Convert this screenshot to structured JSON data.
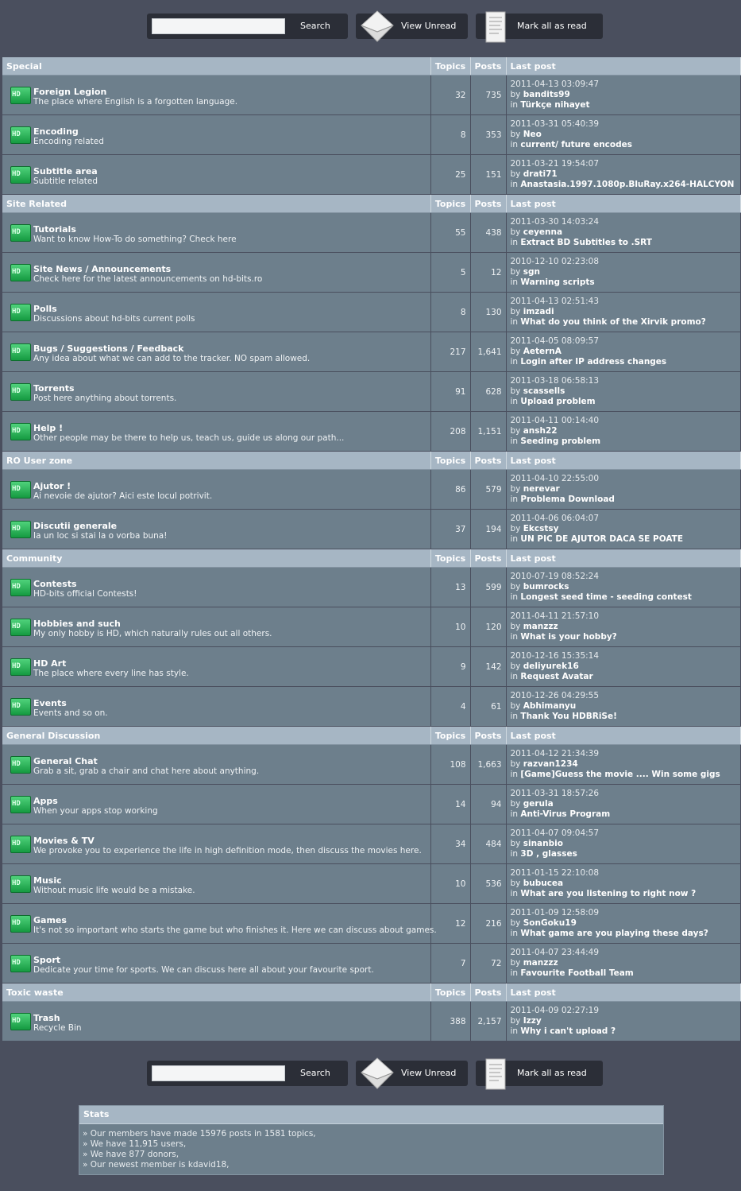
{
  "toolbar": {
    "search_value": "",
    "search_label": "Search",
    "view_unread_label": "View Unread",
    "mark_read_label": "Mark all as read"
  },
  "headers": {
    "topics": "Topics",
    "posts": "Posts",
    "last_post": "Last post"
  },
  "icon_text": "HD",
  "categories": [
    {
      "name": "Special",
      "forums": [
        {
          "title": "Foreign Legion",
          "desc": "The place where English is a forgotten language.",
          "topics": "32",
          "posts": "735",
          "date": "2011-04-13 03:09:47",
          "by": "bandits99",
          "in": "Türkçe nihayet"
        },
        {
          "title": "Encoding",
          "desc": "Encoding related",
          "topics": "8",
          "posts": "353",
          "date": "2011-03-31 05:40:39",
          "by": "Neo",
          "in": "current/ future encodes"
        },
        {
          "title": "Subtitle area",
          "desc": "Subtitle related",
          "topics": "25",
          "posts": "151",
          "date": "2011-03-21 19:54:07",
          "by": "drati71",
          "in": "Anastasia.1997.1080p.BluRay.x264-HALCYON"
        }
      ]
    },
    {
      "name": "Site Related",
      "forums": [
        {
          "title": "Tutorials",
          "desc": "Want to know How-To do something? Check here",
          "topics": "55",
          "posts": "438",
          "date": "2011-03-30 14:03:24",
          "by": "ceyenna",
          "in": "Extract BD Subtitles to .SRT"
        },
        {
          "title": "Site News / Announcements",
          "desc": "Check here for the latest announcements on hd-bits.ro",
          "topics": "5",
          "posts": "12",
          "date": "2010-12-10 02:23:08",
          "by": "sgn",
          "in": "Warning scripts"
        },
        {
          "title": "Polls",
          "desc": "Discussions about hd-bits current polls",
          "topics": "8",
          "posts": "130",
          "date": "2011-04-13 02:51:43",
          "by": "imzadi",
          "in": "What do you think of the Xirvik promo?"
        },
        {
          "title": "Bugs / Suggestions / Feedback",
          "desc": "Any idea about what we can add to the tracker. NO spam allowed.",
          "topics": "217",
          "posts": "1,641",
          "date": "2011-04-05 08:09:57",
          "by": "AeternA",
          "in": "Login after IP address changes"
        },
        {
          "title": "Torrents",
          "desc": "Post here anything about torrents.",
          "topics": "91",
          "posts": "628",
          "date": "2011-03-18 06:58:13",
          "by": "scassells",
          "in": "Upload problem"
        },
        {
          "title": "Help !",
          "desc": "Other people may be there to help us, teach us, guide us along our path...",
          "topics": "208",
          "posts": "1,151",
          "date": "2011-04-11 00:14:40",
          "by": "ansh22",
          "in": "Seeding problem"
        }
      ]
    },
    {
      "name": "RO User zone",
      "forums": [
        {
          "title": "Ajutor !",
          "desc": "Ai nevoie de ajutor? Aici este locul potrivit.",
          "topics": "86",
          "posts": "579",
          "date": "2011-04-10 22:55:00",
          "by": "nerevar",
          "in": "Problema Download"
        },
        {
          "title": "Discutii generale",
          "desc": "Ia un loc si stai la o vorba buna!",
          "topics": "37",
          "posts": "194",
          "date": "2011-04-06 06:04:07",
          "by": "Ekcstsy",
          "in": "UN PIC DE AJUTOR DACA SE POATE"
        }
      ]
    },
    {
      "name": "Community",
      "forums": [
        {
          "title": "Contests",
          "desc": "HD-bits official Contests!",
          "topics": "13",
          "posts": "599",
          "date": "2010-07-19 08:52:24",
          "by": "bumrocks",
          "in": "Longest seed time - seeding contest"
        },
        {
          "title": "Hobbies and such",
          "desc": "My only hobby is HD, which naturally rules out all others.",
          "topics": "10",
          "posts": "120",
          "date": "2011-04-11 21:57:10",
          "by": "manzzz",
          "in": "What is your hobby?"
        },
        {
          "title": "HD Art",
          "desc": "The place where every line has style.",
          "topics": "9",
          "posts": "142",
          "date": "2010-12-16 15:35:14",
          "by": "deliyurek16",
          "in": "Request Avatar"
        },
        {
          "title": "Events",
          "desc": "Events and so on.",
          "topics": "4",
          "posts": "61",
          "date": "2010-12-26 04:29:55",
          "by": "Abhimanyu",
          "in": "Thank You HDBRiSe!"
        }
      ]
    },
    {
      "name": "General Discussion",
      "forums": [
        {
          "title": "General Chat",
          "desc": "Grab a sit, grab a chair and chat here about anything.",
          "topics": "108",
          "posts": "1,663",
          "date": "2011-04-12 21:34:39",
          "by": "razvan1234",
          "in": "[Game]Guess the movie .... Win some gigs"
        },
        {
          "title": "Apps",
          "desc": "When your apps stop working",
          "topics": "14",
          "posts": "94",
          "date": "2011-03-31 18:57:26",
          "by": "gerula",
          "in": "Anti-Virus Program"
        },
        {
          "title": "Movies & TV",
          "desc": "We provoke you to experience the life in high definition mode, then discuss the movies here.",
          "topics": "34",
          "posts": "484",
          "date": "2011-04-07 09:04:57",
          "by": "sinanbio",
          "in": "3D , glasses"
        },
        {
          "title": "Music",
          "desc": "Without music life would be a mistake.",
          "topics": "10",
          "posts": "536",
          "date": "2011-01-15 22:10:08",
          "by": "bubucea",
          "in": "What are you listening to right now ?"
        },
        {
          "title": "Games",
          "desc": "It's not so important who starts the game but who finishes it. Here we can discuss about games.",
          "topics": "12",
          "posts": "216",
          "date": "2011-01-09 12:58:09",
          "by": "SonGoku19",
          "in": "What game are you playing these days?"
        },
        {
          "title": "Sport",
          "desc": "Dedicate your time for sports. We can discuss here all about your favourite sport.",
          "topics": "7",
          "posts": "72",
          "date": "2011-04-07 23:44:49",
          "by": "manzzz",
          "in": "Favourite Football Team"
        }
      ]
    },
    {
      "name": "Toxic waste",
      "forums": [
        {
          "title": "Trash",
          "desc": "Recycle Bin",
          "topics": "388",
          "posts": "2,157",
          "date": "2011-04-09 02:27:19",
          "by": "Izzy",
          "in": "Why i can't upload ?"
        }
      ]
    }
  ],
  "stats": {
    "title": "Stats",
    "lines": [
      "» Our members have made 15976 posts in 1581 topics,",
      "» We have 11,915 users,",
      "» We have 877 donors,",
      "» Our newest member is kdavid18,"
    ]
  }
}
